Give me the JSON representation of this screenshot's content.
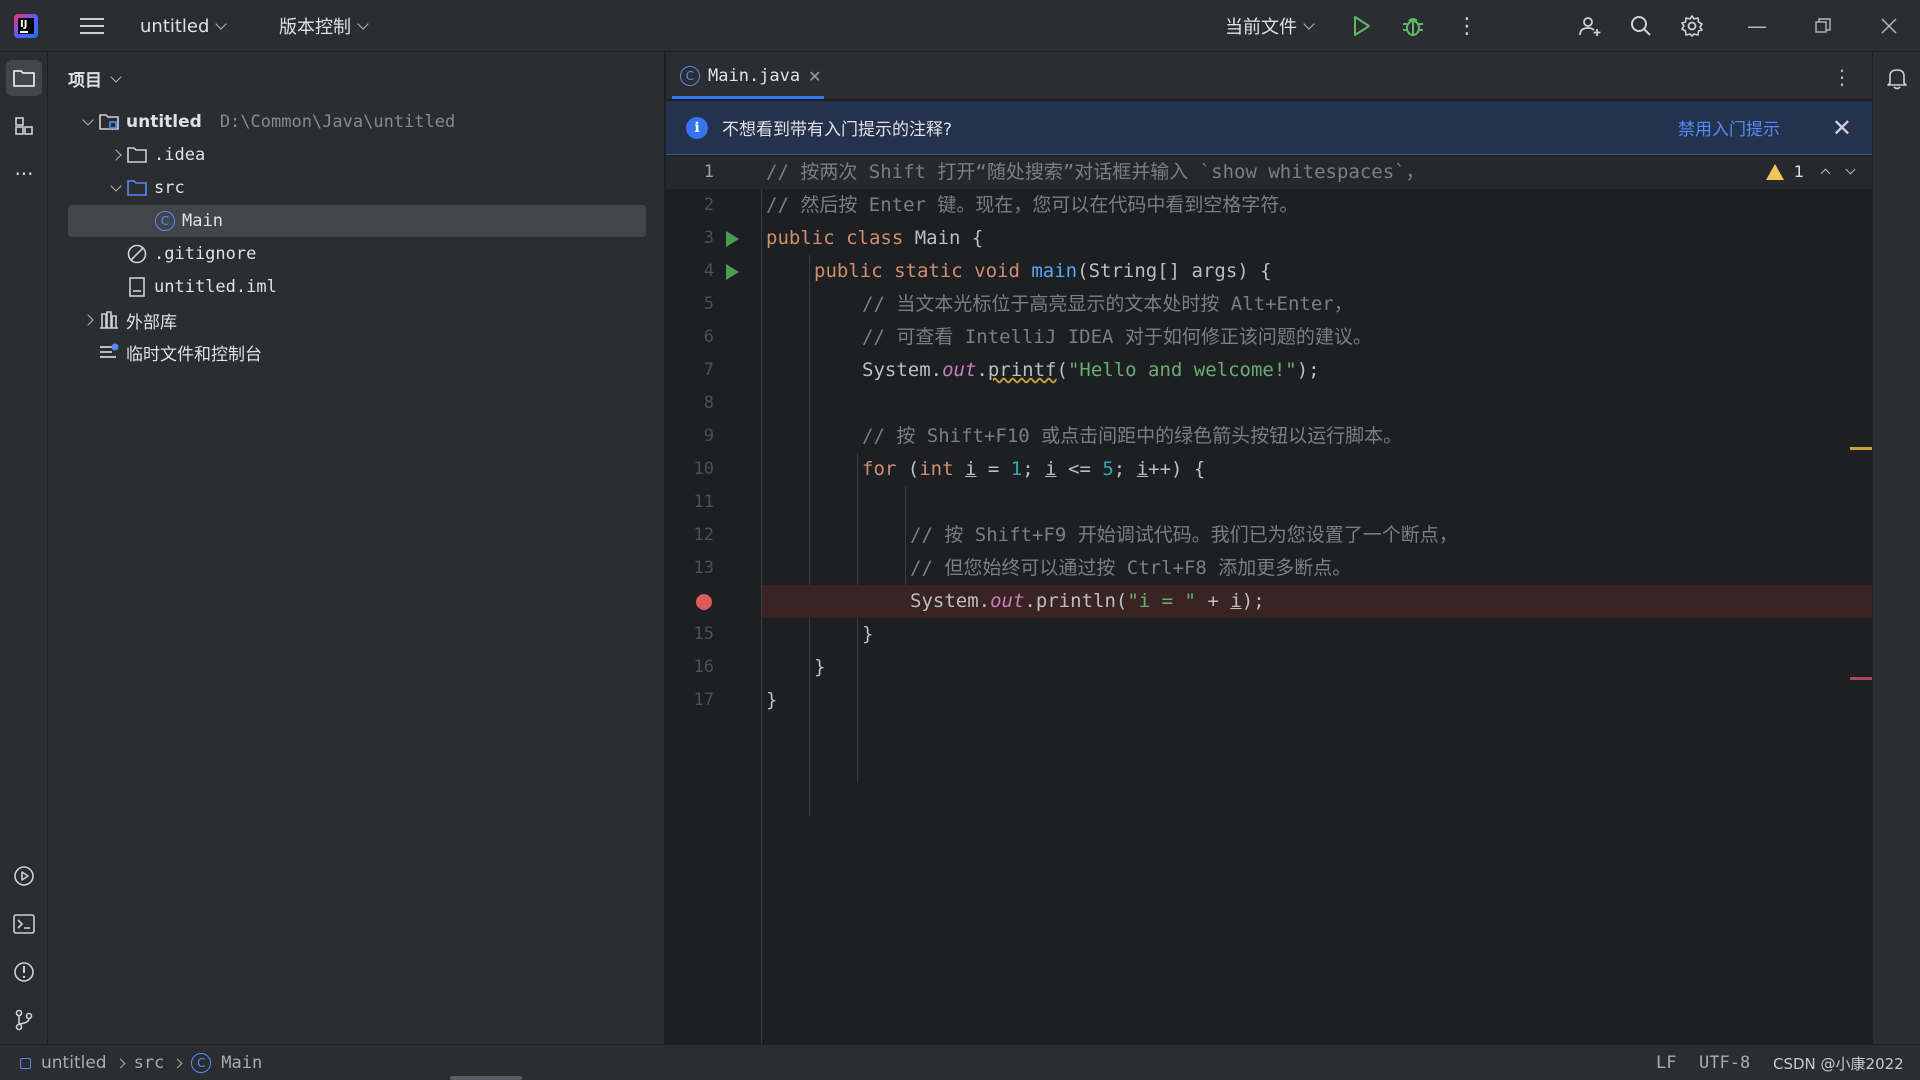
{
  "titlebar": {
    "project_name": "untitled",
    "vcs_menu": "版本控制",
    "run_config": "当前文件"
  },
  "project_panel": {
    "title": "项目",
    "tree": [
      {
        "label": "untitled",
        "hint": "D:\\Common\\Java\\untitled",
        "depth": 0,
        "expanded": true,
        "icon": "module-folder-icon"
      },
      {
        "label": ".idea",
        "depth": 1,
        "expanded": false,
        "icon": "folder-icon"
      },
      {
        "label": "src",
        "depth": 1,
        "expanded": true,
        "icon": "source-folder-icon"
      },
      {
        "label": "Main",
        "depth": 2,
        "selected": true,
        "icon": "java-class-icon"
      },
      {
        "label": ".gitignore",
        "depth": 1,
        "icon": "ignored-file-icon"
      },
      {
        "label": "untitled.iml",
        "depth": 1,
        "icon": "iml-file-icon"
      },
      {
        "label": "外部库",
        "depth": 0,
        "expanded": false,
        "icon": "library-icon"
      },
      {
        "label": "临时文件和控制台",
        "depth": 0,
        "icon": "scratches-icon"
      }
    ]
  },
  "editor": {
    "tab_label": "Main.java",
    "banner": {
      "text": "不想看到带有入门提示的注释?",
      "link": "禁用入门提示"
    },
    "warnings_count": "1",
    "line_numbers": [
      "1",
      "2",
      "3",
      "4",
      "5",
      "6",
      "7",
      "8",
      "9",
      "10",
      "11",
      "12",
      "13",
      "",
      "15",
      "16",
      "17"
    ],
    "code": {
      "l1": "// 按两次 Shift 打开“随处搜索”对话框并输入 `show whitespaces`，",
      "l2": "// 然后按 Enter 键。现在，您可以在代码中看到空格字符。",
      "l3_kw": "public class",
      "l3_name": " Main {",
      "l4_kw": "public static void",
      "l4_fn": "main",
      "l4_rest": "(String[] args) {",
      "l5": "// 当文本光标位于高亮显示的文本处时按 Alt+Enter，",
      "l6": "// 可查看 IntelliJ IDEA 对于如何修正该问题的建议。",
      "l7_a": "System.",
      "l7_out": "out",
      "l7_dot": ".",
      "l7_fn": "printf",
      "l7_p": "(",
      "l7_str": "\"Hello and welcome!\"",
      "l7_end": ");",
      "l9": "// 按 Shift+F10 或点击间距中的绿色箭头按钮以运行脚本。",
      "l10_for": "for",
      "l10_b": " (",
      "l10_int": "int",
      "l10_i1": "i",
      "l10_eq": " = ",
      "l10_one": "1",
      "l10_semi": "; ",
      "l10_i2": "i",
      "l10_le": " <= ",
      "l10_five": "5",
      "l10_semi2": "; ",
      "l10_i3": "i",
      "l10_end": "++) {",
      "l12": "// 按 Shift+F9 开始调试代码。我们已为您设置了一个断点，",
      "l13": "// 但您始终可以通过按 Ctrl+F8 添加更多断点。",
      "l14_a": "System.",
      "l14_out": "out",
      "l14_b": ".println(",
      "l14_str": "\"i = \"",
      "l14_plus": " + ",
      "l14_i": "i",
      "l14_end": ");",
      "l15": "}",
      "l16": "}",
      "l17": "}"
    }
  },
  "statusbar": {
    "crumbs": [
      "untitled",
      "src",
      "Main"
    ],
    "line_sep": "LF",
    "encoding": "UTF-8",
    "watermark": "CSDN @小康2022"
  },
  "colors": {
    "accent": "#3574f0",
    "run_green": "#499c54",
    "breakpoint_red": "#db5c5c",
    "warning_yellow": "#f2c55c"
  }
}
